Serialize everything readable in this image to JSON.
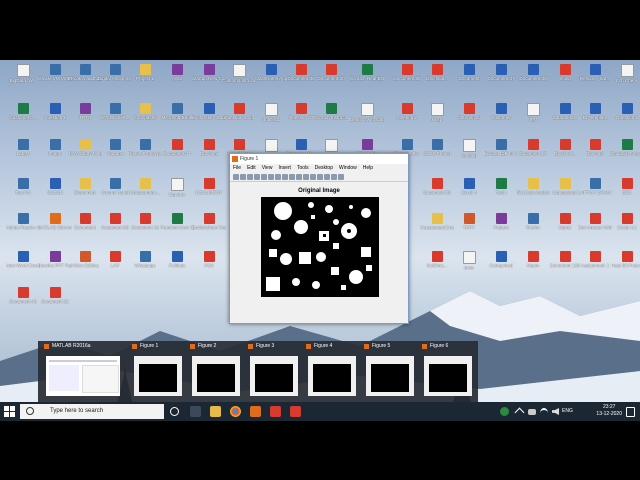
{
  "desktop": {
    "icons": [
      {
        "label": "BigData_W...",
        "type": "txt"
      },
      {
        "label": "Oracle VM VirtualBox",
        "type": "app"
      },
      {
        "label": "PKcatch aadhaar...",
        "type": "app"
      },
      {
        "label": "Digital Assignment...",
        "type": "app"
      },
      {
        "label": "Project 1",
        "type": "fold"
      },
      {
        "label": "AWS",
        "type": "zip"
      },
      {
        "label": "Startup New Case 8",
        "type": "zip"
      },
      {
        "label": "Custom Instructions",
        "type": "txt"
      },
      {
        "label": "ClassNotes App",
        "type": "doc"
      },
      {
        "label": "Document 38",
        "type": "pdf"
      },
      {
        "label": "Document 30",
        "type": "pdf"
      },
      {
        "label": "Scratch Real Estate",
        "type": "xls"
      },
      {
        "label": "Document 35",
        "type": "pdf"
      },
      {
        "label": "Doc final...",
        "type": "pdf"
      },
      {
        "label": "Document",
        "type": "doc"
      },
      {
        "label": "Document 37",
        "type": "doc"
      },
      {
        "label": "Document 36",
        "type": "doc"
      },
      {
        "label": "Shiva",
        "type": "pdf"
      },
      {
        "label": "Resume_Sat...",
        "type": "doc"
      },
      {
        "label": "Itch Check",
        "type": "txt"
      },
      {
        "label": "CustomerD...",
        "type": "xls"
      },
      {
        "label": "Question 1",
        "type": "doc"
      },
      {
        "label": "TRTS",
        "type": "zip"
      },
      {
        "label": "SNACKSHR...",
        "type": "app"
      },
      {
        "label": "Copypastel",
        "type": "fold"
      },
      {
        "label": "Microsoft Edge",
        "type": "app"
      },
      {
        "label": "Exploratory Data Analysis",
        "type": "doc"
      },
      {
        "label": "Question 1.pdf",
        "type": "pdf"
      },
      {
        "label": "Untitled1",
        "type": "txt"
      },
      {
        "label": "Question 37",
        "type": "pdf"
      },
      {
        "label": "Scratch Instructions",
        "type": "xls"
      },
      {
        "label": "Dealing with Categories",
        "type": "txt"
      },
      {
        "label": "Meeting 7",
        "type": "pdf"
      },
      {
        "label": "Hosp",
        "type": "txt"
      },
      {
        "label": "Categorical",
        "type": "pdf"
      },
      {
        "label": "Customer",
        "type": "doc"
      },
      {
        "label": "Test",
        "type": "txt"
      },
      {
        "label": "SataduMa...",
        "type": "doc"
      },
      {
        "label": "DI Template",
        "type": "doc"
      },
      {
        "label": "Question 2",
        "type": "doc"
      },
      {
        "label": "Latest",
        "type": "app"
      },
      {
        "label": "Image",
        "type": "app"
      },
      {
        "label": "JAVA Study Material",
        "type": "fold"
      },
      {
        "label": "Youtube",
        "type": "app"
      },
      {
        "label": "Ruave Prototype",
        "type": "app"
      },
      {
        "label": "Document 44",
        "type": "pdf"
      },
      {
        "label": "Doc final",
        "type": "pdf"
      },
      {
        "label": "Hosted Data",
        "type": "pdf"
      },
      {
        "label": "Q4",
        "type": "txt"
      },
      {
        "label": "Resume_Ma...",
        "type": "doc"
      },
      {
        "label": "ELP Login",
        "type": "txt"
      },
      {
        "label": "PIE 30 File",
        "type": "zip"
      },
      {
        "label": "Recycle Bin",
        "type": "app"
      },
      {
        "label": "SSCS Project",
        "type": "app"
      },
      {
        "label": "Untitled",
        "type": "txt"
      },
      {
        "label": "Eclipse IDE for Java Dev",
        "type": "app"
      },
      {
        "label": "Document 17",
        "type": "pdf"
      },
      {
        "label": "Doc final...",
        "type": "pdf"
      },
      {
        "label": "Doc final",
        "type": "pdf"
      },
      {
        "label": "Standard Answer Sheet",
        "type": "xls"
      },
      {
        "label": "Test VC",
        "type": "app"
      },
      {
        "label": "SSCSD",
        "type": "doc"
      },
      {
        "label": "Ewmr nitty",
        "type": "fold"
      },
      {
        "label": "Control Panel",
        "type": "app"
      },
      {
        "label": "Compartmen...",
        "type": "fold"
      },
      {
        "label": "Capture",
        "type": "txt"
      },
      {
        "label": "DOCUMENT",
        "type": "pdf"
      },
      {
        "label": "Document 33",
        "type": "pdf"
      },
      {
        "label": "Excel 4",
        "type": "doc"
      },
      {
        "label": "Teclu",
        "type": "xls"
      },
      {
        "label": "File Date Analysis",
        "type": "fold"
      },
      {
        "label": "Copypasted",
        "type": "fold"
      },
      {
        "label": "LAPTOP DRAWING",
        "type": "app"
      },
      {
        "label": "DBC",
        "type": "pdf"
      },
      {
        "label": "Adobe Reader XI",
        "type": "app"
      },
      {
        "label": "MATLAB Shortcut",
        "type": "mat"
      },
      {
        "label": "Document",
        "type": "pdf"
      },
      {
        "label": "Document 08",
        "type": "pdf"
      },
      {
        "label": "Document 16",
        "type": "pdf"
      },
      {
        "label": "Premium New Stuff",
        "type": "xls"
      },
      {
        "label": "Brokenchain Test",
        "type": "pdf"
      },
      {
        "label": "Copypasted Drafting",
        "type": "fold"
      },
      {
        "label": "TPPT",
        "type": "ppt"
      },
      {
        "label": "Pattern",
        "type": "zip"
      },
      {
        "label": "Firefox",
        "type": "app"
      },
      {
        "label": "Name",
        "type": "pdf"
      },
      {
        "label": "Dev Answer Writeup",
        "type": "pdf"
      },
      {
        "label": "Excel 4.2",
        "type": "pdf"
      },
      {
        "label": "New Word Document",
        "type": "doc"
      },
      {
        "label": "Rewrite PPT Report",
        "type": "zip"
      },
      {
        "label": "Video Editing",
        "type": "ppt"
      },
      {
        "label": "LAP",
        "type": "pdf"
      },
      {
        "label": "Whatsapp",
        "type": "app"
      },
      {
        "label": "Fulldata",
        "type": "doc"
      },
      {
        "label": "PDS",
        "type": "pdf"
      },
      {
        "label": "Sublime...",
        "type": "pdf"
      },
      {
        "label": "pass",
        "type": "txt"
      },
      {
        "label": "Categorical",
        "type": "doc"
      },
      {
        "label": "Naam",
        "type": "pdf"
      },
      {
        "label": "Document 150",
        "type": "pdf"
      },
      {
        "label": "Assignment 1",
        "type": "pdf"
      },
      {
        "label": "Heat 08 Project",
        "type": "pdf"
      },
      {
        "label": "Document 45",
        "type": "pdf"
      },
      {
        "label": "Document 31",
        "type": "pdf"
      }
    ]
  },
  "figure_window": {
    "title": "Figure 1",
    "menu": [
      "File",
      "Edit",
      "View",
      "Insert",
      "Tools",
      "Desktop",
      "Window",
      "Help"
    ],
    "plot_title": "Original Image"
  },
  "thumbnails": [
    {
      "label": "MATLAB R2016a"
    },
    {
      "label": "Figure 1"
    },
    {
      "label": "Figure 2"
    },
    {
      "label": "Figure 3"
    },
    {
      "label": "Figure 4"
    },
    {
      "label": "Figure 5"
    },
    {
      "label": "Figure 6"
    }
  ],
  "taskbar": {
    "search_placeholder": "Type here to search",
    "language": "ENG",
    "time": "23:27",
    "date": "13-12-2020"
  }
}
